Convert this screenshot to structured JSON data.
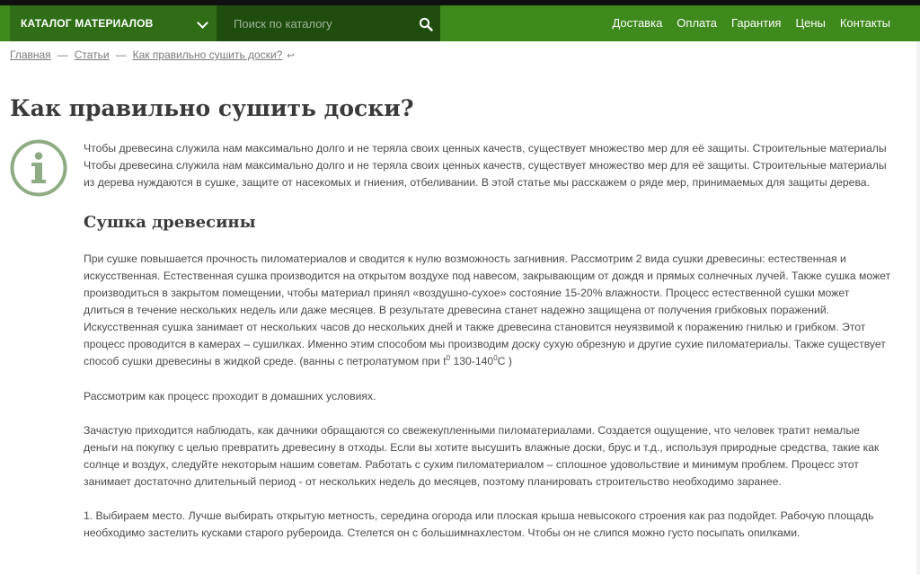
{
  "nav": {
    "catalog_label": "КАТАЛОГ МАТЕРИАЛОВ",
    "search_placeholder": "Поиск по каталогу",
    "menu": [
      "Доставка",
      "Оплата",
      "Гарантия",
      "Цены",
      "Контакты"
    ]
  },
  "breadcrumb": {
    "home": "Главная",
    "articles": "Статьи",
    "current": "Как правильно сушить доски?",
    "separator": "—"
  },
  "page": {
    "title": "Как правильно сушить доски?"
  },
  "article": {
    "intro": "Чтобы древесина служила нам максимально долго и не теряла своих ценных качеств, существует множество мер для её защиты. Строительные материалы Чтобы древесина служила нам максимально долго и не теряла своих ценных качеств, существует множество мер для её защиты. Строительные материалы из дерева нуждаются в сушке, защите от насекомых и гниения, отбеливании. В этой статье мы расскажем о ряде мер, принимаемых для защиты дерева.",
    "section_title": "Сушка древесины",
    "p1": "При сушке повышается прочность пиломатериалов и сводится к нулю возможность загнивния. Рассмотрим 2 вида сушки древесины: естественная и искусственная. Естественная сушка производится на открытом воздухе под навесом, закрывающим от дождя и прямых солнечных лучей. Также сушка может производиться в закрытом помещении, чтобы материал принял «воздушно-сухое» состояние 15-20% влажности. Процесс естественной сушки может длиться в течение нескольких недель или даже месяцев. В результате древесина станет надежно защищена от получения грибковых поражений.",
    "p2_main": "Искусственная сушка занимает от нескольких часов до нескольких дней и также древесина становится неуязвимой к поражению гнилью и грибком. Этот процесс проводится в камерах – сушилках. Именно этим способом мы производим доску сухую обрезную и другие сухие пиломатериалы. Также существует способ сушки древесины в жидкой среде. (ванны с петролатумом при t",
    "p2_sup1": "0",
    "p2_mid": " 130-140",
    "p2_sup2": "0",
    "p2_end": "C )",
    "p3": "Рассмотрим как процесс проходит в домашних условиях.",
    "p4": "Зачастую приходится наблюдать, как дачники обращаются со свежекупленными пиломатериалами. Создается ощущение, что человек тратит немалые деньги на покупку с целью превратить древесину в отходы. Если вы хотите высушить влажные доски, брус и т.д., используя природные средства, такие как солнце и воздух,  следуйте некоторым нашим советам. Работать с сухим пиломатериалом – сплошное удовольствие и минимум проблем. Процесс этот занимает достаточно длительный период - от нескольких недель до месяцев, поэтому планировать строительство необходимо заранее.",
    "p5": "1. Выбираем место. Лучше выбирать открытую метность, середина огорода или плоская крыша невысокого строения как раз подойдет. Рабочую площадь необходимо застелить кусками старого рубероида. Стелется он с большимнахлестом. Чтобы он не слипся можно густо посыпать опилками."
  },
  "colors": {
    "nav_green": "#3e8a1c",
    "catalog_green": "#2f6e16",
    "search_bg": "#1f4d0d",
    "icon_green": "#8fab84"
  }
}
